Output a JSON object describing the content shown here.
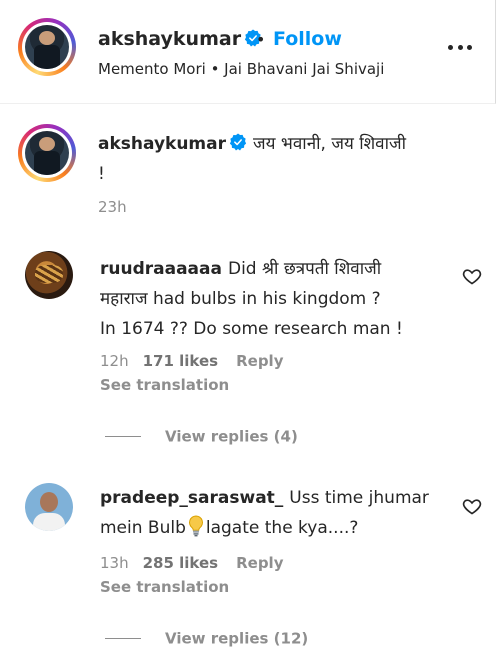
{
  "post_header": {
    "username": "akshaykumar",
    "separator": "•",
    "follow_label": "Follow",
    "subtitle": "Memento Mori • Jai Bhavani Jai Shivaji"
  },
  "caption": {
    "username": "akshaykumar",
    "text_line1": "जय भवानी, जय शिवाजी",
    "text_line2": "!",
    "time": "23h"
  },
  "comments": [
    {
      "username": "ruudraaaaaa",
      "line1": "Did श्री छत्रपती शिवाजी",
      "line2": "महाराज had bulbs in his kingdom ?",
      "line3": "In 1674 ?? Do some research man !",
      "time": "12h",
      "likes": "171 likes",
      "reply_label": "Reply",
      "see_translation": "See translation",
      "view_replies": "View replies (4)"
    },
    {
      "username": "pradeep_saraswat_",
      "line1": "Uss time jhumar",
      "line2a": "mein Bulb",
      "line2b": "lagate the kya....?",
      "emoji": "light-bulb-emoji",
      "time": "13h",
      "likes": "285 likes",
      "reply_label": "Reply",
      "see_translation": "See translation",
      "view_replies": "View replies (12)"
    }
  ],
  "colors": {
    "accent": "#0095f6",
    "verified": "#0095f6",
    "muted": "#8e8e8e",
    "text": "#262626"
  }
}
